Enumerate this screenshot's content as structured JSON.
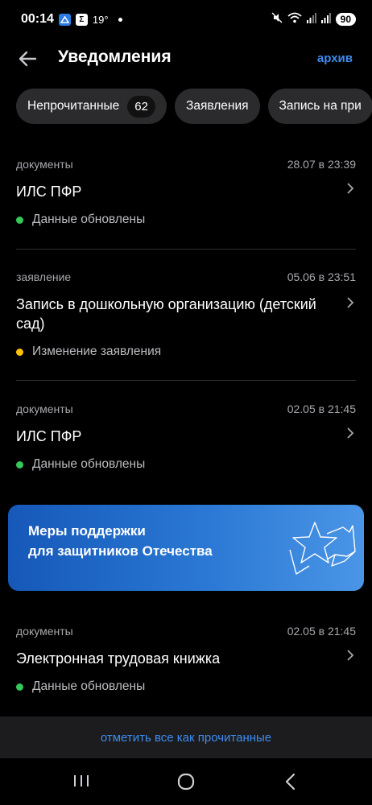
{
  "status_bar": {
    "time": "00:14",
    "notif_icons": [
      "app-icon-blue",
      "sigma-icon"
    ],
    "sigma_glyph": "Σ",
    "temperature": "19°",
    "battery": "90"
  },
  "header": {
    "back_icon": "arrow-left-icon",
    "title": "Уведомления",
    "archive_label": "архив"
  },
  "filters": [
    {
      "label": "Непрочитанные",
      "count": "62"
    },
    {
      "label": "Заявления"
    },
    {
      "label": "Запись на при"
    }
  ],
  "notifications": [
    {
      "category": "документы",
      "date": "28.07 в 23:39",
      "title": "ИЛС ПФР",
      "status": "Данные обновлены",
      "status_color": "#34c759"
    },
    {
      "category": "заявление",
      "date": "05.06 в 23:51",
      "title": "Запись в дошкольную организацию (детский сад)",
      "status": "Изменение заявления",
      "status_color": "#ffc107"
    },
    {
      "category": "документы",
      "date": "02.05 в 21:45",
      "title": "ИЛС ПФР",
      "status": "Данные обновлены",
      "status_color": "#34c759"
    },
    {
      "category": "документы",
      "date": "02.05 в 21:45",
      "title": "Электронная трудовая книжка",
      "status": "Данные обновлены",
      "status_color": "#34c759"
    }
  ],
  "banner": {
    "line1": "Меры поддержки",
    "line2": "для защитников Отечества"
  },
  "bottom": {
    "mark_all_read": "отметить все как прочитанные"
  },
  "colors": {
    "accent": "#3d8cf0",
    "background": "#000000",
    "chip_bg": "#2b2b2e"
  },
  "nav": [
    "recent-apps-icon",
    "home-icon",
    "back-icon"
  ]
}
